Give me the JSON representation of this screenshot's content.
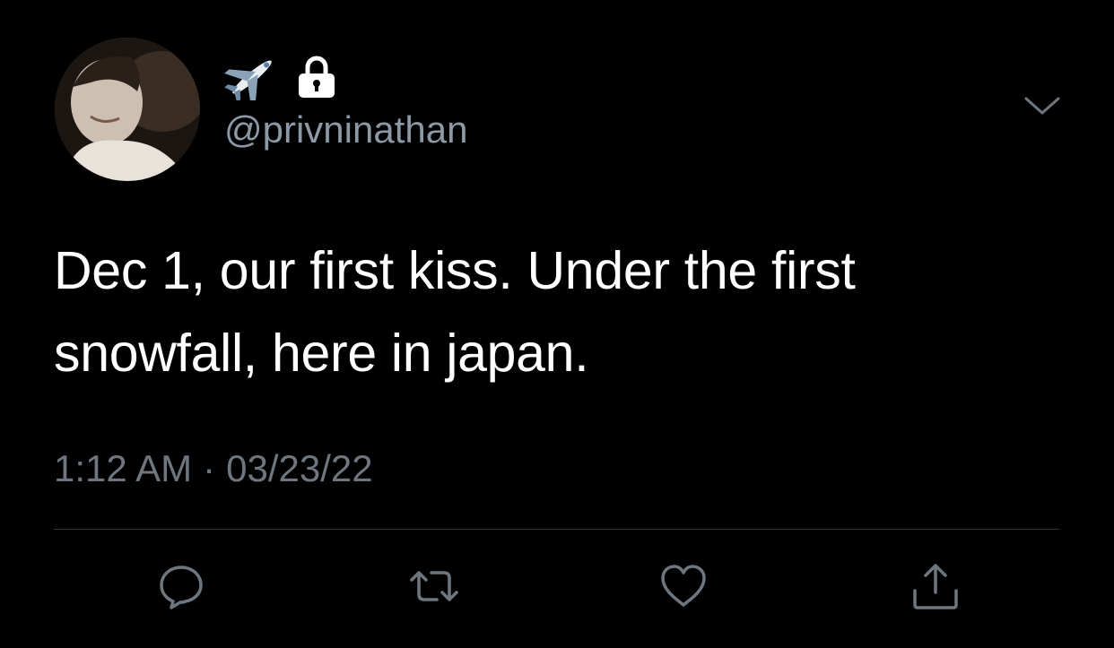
{
  "user": {
    "handle": "@privninathan",
    "display_icons": [
      "airplane-emoji",
      "lock-icon"
    ]
  },
  "tweet": {
    "text": "Dec 1, our first kiss. Under the first snowfall, here in japan.",
    "time": "1:12 AM",
    "separator": "·",
    "date": "03/23/22"
  },
  "actions": [
    {
      "name": "reply",
      "icon": "comment-icon"
    },
    {
      "name": "retweet",
      "icon": "retweet-icon"
    },
    {
      "name": "like",
      "icon": "heart-icon"
    },
    {
      "name": "share",
      "icon": "share-icon"
    }
  ],
  "colors": {
    "background": "#000000",
    "text": "#ffffff",
    "secondary": "#8b98a5",
    "icon": "#6e7780",
    "divider": "#2f3336"
  }
}
